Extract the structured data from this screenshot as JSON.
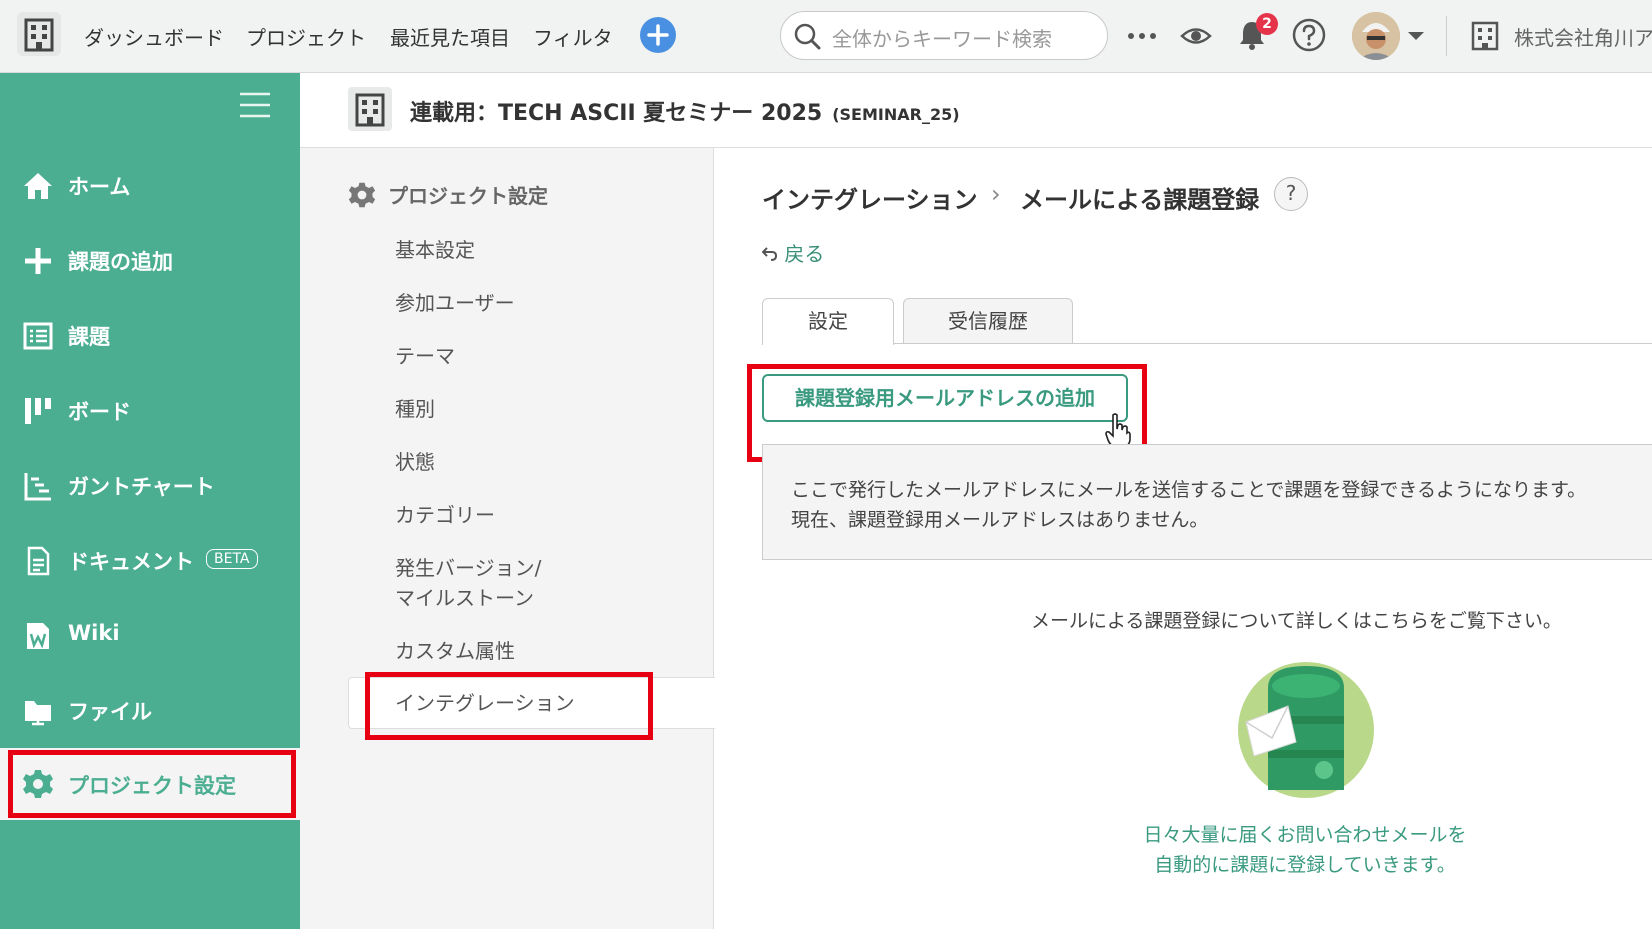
{
  "topbar": {
    "nav": [
      "ダッシュボード",
      "プロジェクト",
      "最近見た項目",
      "フィルタ"
    ],
    "search_placeholder": "全体からキーワード検索",
    "notification_count": "2",
    "company": "株式会社角川ア"
  },
  "sidebar": {
    "items": [
      {
        "label": "ホーム"
      },
      {
        "label": "課題の追加"
      },
      {
        "label": "課題"
      },
      {
        "label": "ボード"
      },
      {
        "label": "ガントチャート"
      },
      {
        "label": "ドキュメント",
        "badge": "BETA"
      },
      {
        "label": "Wiki"
      },
      {
        "label": "ファイル"
      },
      {
        "label": "プロジェクト設定"
      }
    ]
  },
  "project": {
    "title": "連載用：TECH ASCII 夏セミナー 2025",
    "key": "(SEMINAR_25)"
  },
  "settings_nav": {
    "heading": "プロジェクト設定",
    "items": [
      "基本設定",
      "参加ユーザー",
      "テーマ",
      "種別",
      "状態",
      "カテゴリー",
      "発生バージョン/",
      "マイルストーン",
      "カスタム属性",
      "インテグレーション"
    ]
  },
  "main": {
    "breadcrumb_parent": "インテグレーション",
    "breadcrumb_sep": "›",
    "breadcrumb_current": "メールによる課題登録",
    "help": "?",
    "back_label": "戻る",
    "tabs": [
      "設定",
      "受信履歴"
    ],
    "add_button": "課題登録用メールアドレスの追加",
    "info_line1": "ここで発行したメールアドレスにメールを送信することで課題を登録できるようになります。",
    "info_line2": "現在、課題登録用メールアドレスはありません。",
    "detail_text": "メールによる課題登録について詳しくはこちらをご覧下さい。",
    "promo_line1": "日々大量に届くお問い合わせメールを",
    "promo_line2": "自動的に課題に登録していきます。"
  },
  "colors": {
    "sidebar_green": "#4cae91",
    "accent_green": "#3a9a7f",
    "highlight_red": "#e60012",
    "plus_blue": "#4a90e2"
  }
}
